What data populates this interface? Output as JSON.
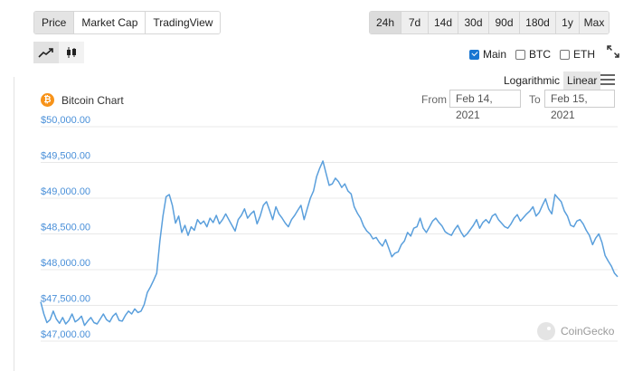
{
  "tabs": [
    {
      "label": "Price",
      "active": true
    },
    {
      "label": "Market Cap",
      "active": false
    },
    {
      "label": "TradingView",
      "active": false
    }
  ],
  "ranges": [
    {
      "label": "24h",
      "active": true
    },
    {
      "label": "7d",
      "active": false
    },
    {
      "label": "14d",
      "active": false
    },
    {
      "label": "30d",
      "active": false
    },
    {
      "label": "90d",
      "active": false
    },
    {
      "label": "180d",
      "active": false
    },
    {
      "label": "1y",
      "active": false
    },
    {
      "label": "Max",
      "active": false
    }
  ],
  "chart_types": [
    {
      "name": "line-chart-icon",
      "active": true
    },
    {
      "name": "candlestick-chart-icon",
      "active": false
    }
  ],
  "toggles": [
    {
      "label": "Main",
      "checked": true
    },
    {
      "label": "BTC",
      "checked": false
    },
    {
      "label": "ETH",
      "checked": false
    }
  ],
  "scale": {
    "logarithmic": "Logarithmic",
    "linear": "Linear",
    "active": "Linear"
  },
  "chart_title": "Bitcoin Chart",
  "coin_symbol": "₿",
  "date_range": {
    "from_label": "From",
    "from": "Feb 14, 2021",
    "to_label": "To",
    "to": "Feb 15, 2021"
  },
  "watermark": "CoinGecko",
  "colors": {
    "line": "#5a9fdc",
    "axis_text": "#4a90d9",
    "grid": "#e8e8e8",
    "btc": "#f7931a"
  },
  "chart_data": {
    "type": "line",
    "title": "Bitcoin Chart",
    "y_tick_labels": [
      "$50,000.00",
      "$49,500.00",
      "$49,000.00",
      "$48,500.00",
      "$48,000.00",
      "$47,500.00",
      "$47,000.00"
    ],
    "y_ticks": [
      50000,
      49500,
      49000,
      48500,
      48000,
      47500,
      47000
    ],
    "ylim": [
      47000,
      50000
    ],
    "grid": true,
    "x": [
      0,
      1,
      2,
      3,
      4,
      5,
      6,
      7,
      8,
      9,
      10,
      11,
      12,
      13,
      14,
      15,
      16,
      17,
      18,
      19,
      20,
      21,
      22,
      23,
      24,
      25,
      26,
      27,
      28,
      29,
      30,
      31,
      32,
      33,
      34,
      35,
      36,
      37,
      38,
      39,
      40,
      41,
      42,
      43,
      44,
      45,
      46,
      47,
      48,
      49,
      50,
      51,
      52,
      53,
      54,
      55,
      56,
      57,
      58,
      59,
      60,
      61,
      62,
      63,
      64,
      65,
      66,
      67,
      68,
      69,
      70,
      71,
      72,
      73,
      74,
      75,
      76,
      77,
      78,
      79,
      80,
      81,
      82,
      83,
      84,
      85,
      86,
      87,
      88,
      89,
      90,
      91,
      92,
      93,
      94,
      95,
      96,
      97,
      98,
      99,
      100,
      101,
      102,
      103,
      104,
      105,
      106,
      107,
      108,
      109,
      110,
      111,
      112,
      113,
      114,
      115,
      116,
      117,
      118,
      119,
      120,
      121,
      122,
      123,
      124,
      125,
      126,
      127,
      128,
      129,
      130,
      131,
      132,
      133,
      134,
      135,
      136,
      137,
      138,
      139,
      140,
      141,
      142,
      143,
      144,
      145,
      146,
      147,
      148,
      149,
      150,
      151,
      152,
      153,
      154,
      155,
      156,
      157,
      158,
      159,
      160,
      161,
      162,
      163,
      164,
      165,
      166,
      167,
      168,
      169,
      170,
      171,
      172,
      173,
      174,
      175,
      176,
      177,
      178,
      179,
      180,
      181,
      182,
      183,
      184,
      185,
      186,
      187,
      188,
      189,
      190,
      191,
      192,
      193,
      194,
      195,
      196,
      197,
      198,
      199,
      200,
      201,
      202,
      203,
      204,
      205,
      206,
      207,
      208,
      209,
      210,
      211,
      212,
      213,
      214,
      215,
      216,
      217,
      218,
      219,
      220,
      221,
      222,
      223,
      224,
      225,
      226,
      227,
      228,
      229,
      230,
      231,
      232,
      233,
      234,
      235,
      236,
      237,
      238,
      239,
      240,
      241,
      242,
      243,
      244,
      245,
      246,
      247,
      248,
      249,
      250,
      251,
      252,
      253,
      254,
      255,
      256,
      257,
      258,
      259,
      260,
      261,
      262,
      263,
      264,
      265,
      266,
      267,
      268,
      269,
      270,
      271,
      272,
      273,
      274,
      275,
      276,
      277,
      278,
      279,
      280,
      281,
      282,
      283,
      284,
      285,
      286,
      287,
      288
    ],
    "values": [
      47550,
      47380,
      47260,
      47300,
      47420,
      47310,
      47250,
      47330,
      47240,
      47290,
      47380,
      47270,
      47300,
      47350,
      47220,
      47280,
      47330,
      47260,
      47240,
      47310,
      47380,
      47300,
      47270,
      47350,
      47390,
      47290,
      47280,
      47360,
      47420,
      47380,
      47450,
      47400,
      47420,
      47510,
      47680,
      47760,
      47850,
      47950,
      48400,
      48750,
      49020,
      49050,
      48900,
      48650,
      48750,
      48520,
      48620,
      48480,
      48600,
      48550,
      48700,
      48640,
      48680,
      48600,
      48720,
      48660,
      48760,
      48640,
      48700,
      48780,
      48700,
      48620,
      48540,
      48700,
      48760,
      48850,
      48720,
      48780,
      48820,
      48640,
      48750,
      48900,
      48950,
      48830,
      48700,
      48880,
      48780,
      48720,
      48650,
      48600,
      48700,
      48760,
      48830,
      48900,
      48700,
      48850,
      49000,
      49100,
      49300,
      49420,
      49520,
      49350,
      49180,
      49200,
      49280,
      49230,
      49150,
      49200,
      49100,
      49060,
      48880,
      48790,
      48720,
      48610,
      48540,
      48500,
      48430,
      48450,
      48380,
      48330,
      48420,
      48300,
      48180,
      48230,
      48250,
      48350,
      48400,
      48520,
      48470,
      48580,
      48600,
      48720,
      48580,
      48520,
      48600,
      48680,
      48720,
      48660,
      48610,
      48530,
      48500,
      48480,
      48560,
      48620,
      48530,
      48460,
      48500,
      48560,
      48620,
      48700,
      48580,
      48660,
      48700,
      48650,
      48750,
      48780,
      48700,
      48650,
      48600,
      48580,
      48640,
      48720,
      48770,
      48680,
      48730,
      48780,
      48820,
      48880,
      48750,
      48800,
      48900,
      48990,
      48850,
      48780,
      49050,
      49000,
      48950,
      48820,
      48750,
      48620,
      48600,
      48680,
      48700,
      48640,
      48550,
      48480,
      48350,
      48440,
      48500,
      48380,
      48200,
      48120,
      48050,
      47950,
      47900
    ],
    "note_values_order": "chronological"
  }
}
